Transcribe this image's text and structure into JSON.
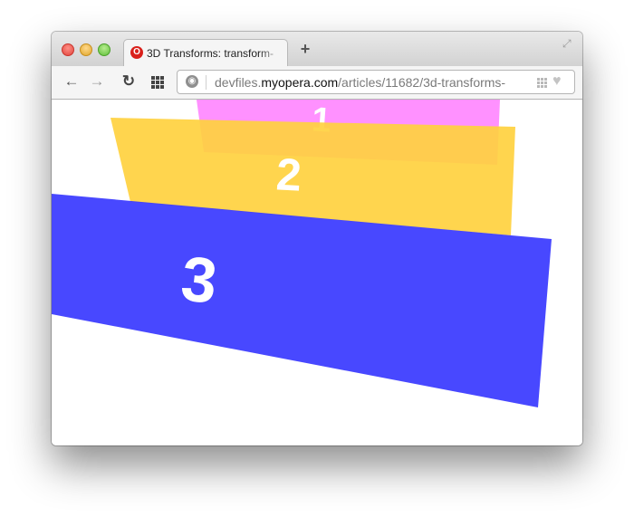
{
  "tab": {
    "title": "3D Transforms: transform-",
    "favicon": "O",
    "new_tab": "+"
  },
  "nav": {
    "back": "←",
    "forward": "→",
    "reload": "↻"
  },
  "address": {
    "url_prefix": "devfiles.",
    "url_domain": "myopera.com",
    "url_path": "/articles/11682/3d-transforms-"
  },
  "panels": [
    {
      "label": "1",
      "color": "#ff88ff"
    },
    {
      "label": "2",
      "color": "#ffd13f"
    },
    {
      "label": "3",
      "color": "#3a3aff"
    }
  ]
}
